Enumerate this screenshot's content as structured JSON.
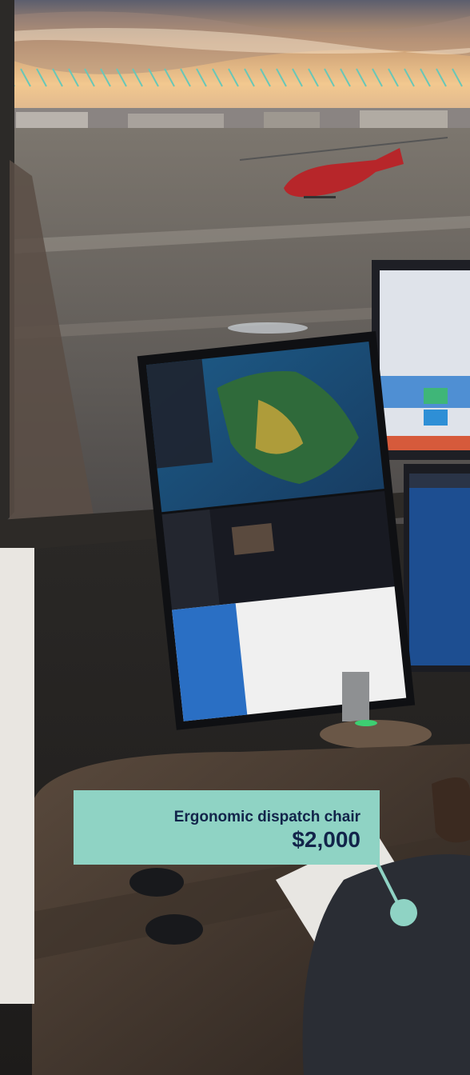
{
  "callout": {
    "item": "Ergonomic dispatch chair",
    "price": "$2,000"
  },
  "colors": {
    "accent": "#8fd3c4",
    "text": "#12244a",
    "panel": "#e9e6e1"
  },
  "scene": {
    "description_icon": "photo-dispatch-center-with-helicopter"
  }
}
